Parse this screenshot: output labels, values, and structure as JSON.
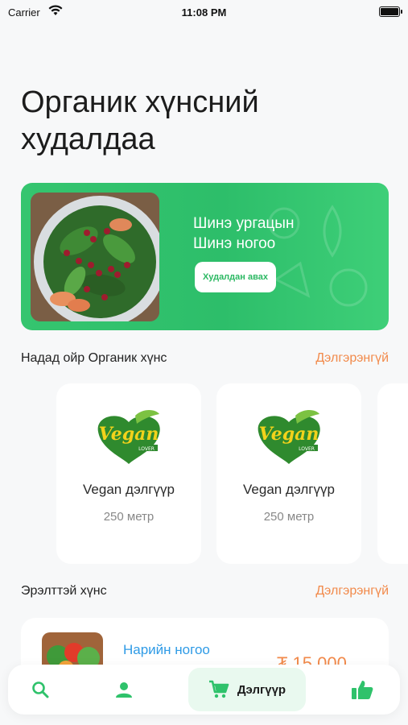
{
  "status": {
    "carrier": "Carrier",
    "time": "11:08 PM"
  },
  "header": {
    "title": "Органик хүнсний худалдаа"
  },
  "banner": {
    "line1": "Шинэ ургацын",
    "line2": "Шинэ ногоо",
    "button": "Худалдан авах"
  },
  "nearby": {
    "label": "Надад ойр Органик хүнс",
    "more": "Дэлгэрэнгүй",
    "stores": [
      {
        "name": "Vegan дэлгүүр",
        "distance": "250 метр",
        "logo_text": "Vegan",
        "logo_sub": "LOVER"
      },
      {
        "name": "Vegan дэлгүүр",
        "distance": "250 метр",
        "logo_text": "Vegan",
        "logo_sub": "LOVER"
      }
    ]
  },
  "popular": {
    "label": "Эрэлттэй хүнс",
    "more": "Дэлгэрэнгүй",
    "product": {
      "name": "Нарийн ногоо",
      "price": "₮ 15 000"
    }
  },
  "tabbar": {
    "shop_label": "Дэлгүүр"
  },
  "colors": {
    "primary": "#2fc26b",
    "accent": "#f28a4b",
    "link": "#2f9be6"
  }
}
